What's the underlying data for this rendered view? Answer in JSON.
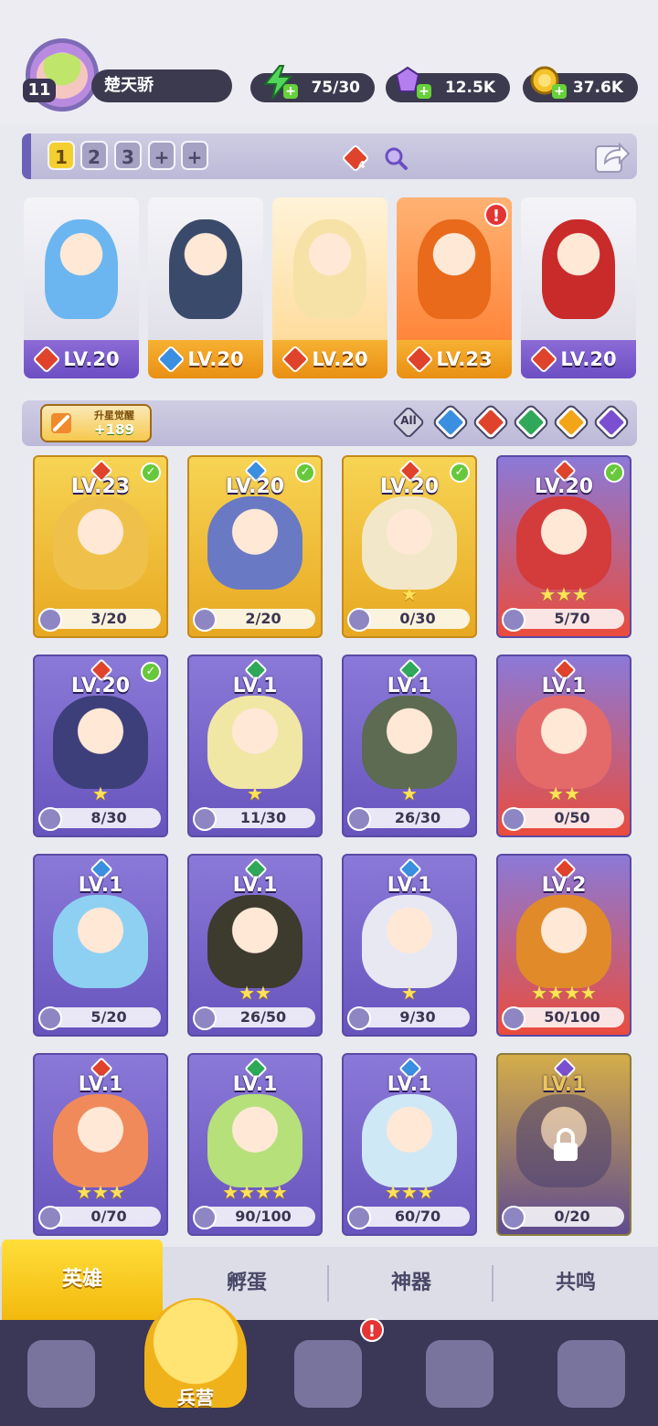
{
  "player": {
    "level": "11",
    "name": "楚天骄"
  },
  "resources": {
    "energy": "75/30",
    "gems": "12.5K",
    "coins": "37.6K"
  },
  "team_tabs": [
    "1",
    "2",
    "3",
    "+",
    "+"
  ],
  "team_indicator": {
    "count": "4"
  },
  "lineup": [
    {
      "level": "LV.20",
      "element": "fire",
      "band": "purple"
    },
    {
      "level": "LV.20",
      "element": "water",
      "band": "gold"
    },
    {
      "level": "LV.20",
      "element": "fire",
      "band": "gold"
    },
    {
      "level": "LV.23",
      "element": "fire",
      "band": "gold",
      "alert": "!"
    },
    {
      "level": "LV.20",
      "element": "fire",
      "band": "purple"
    }
  ],
  "upgrade": {
    "label": "升星觉醒",
    "value": "+189"
  },
  "filters": [
    "All",
    "water",
    "fire",
    "nature",
    "light",
    "dark"
  ],
  "heroes": [
    {
      "level": "LV.23",
      "element": "fire",
      "shards": "3/20",
      "checked": true,
      "style": "gold",
      "stars": 0
    },
    {
      "level": "LV.20",
      "element": "water",
      "shards": "2/20",
      "checked": true,
      "style": "gold",
      "stars": 0
    },
    {
      "level": "LV.20",
      "element": "fire",
      "shards": "0/30",
      "checked": true,
      "style": "gold",
      "stars": 1
    },
    {
      "level": "LV.20",
      "element": "fire",
      "shards": "5/70",
      "checked": true,
      "style": "red",
      "stars": 3
    },
    {
      "level": "LV.20",
      "element": "fire",
      "shards": "8/30",
      "checked": true,
      "style": "purple",
      "stars": 1
    },
    {
      "level": "LV.1",
      "element": "nature",
      "shards": "11/30",
      "checked": false,
      "style": "purple",
      "stars": 1
    },
    {
      "level": "LV.1",
      "element": "nature",
      "shards": "26/30",
      "checked": false,
      "style": "purple",
      "stars": 1
    },
    {
      "level": "LV.1",
      "element": "fire",
      "shards": "0/50",
      "checked": false,
      "style": "red",
      "stars": 2
    },
    {
      "level": "LV.1",
      "element": "water",
      "shards": "5/20",
      "checked": false,
      "style": "purple",
      "stars": 0
    },
    {
      "level": "LV.1",
      "element": "nature",
      "shards": "26/50",
      "checked": false,
      "style": "purple",
      "stars": 2
    },
    {
      "level": "LV.1",
      "element": "water",
      "shards": "9/30",
      "checked": false,
      "style": "purple",
      "stars": 1
    },
    {
      "level": "LV.2",
      "element": "fire",
      "shards": "50/100",
      "checked": false,
      "style": "red",
      "stars": 4
    },
    {
      "level": "LV.1",
      "element": "fire",
      "shards": "0/70",
      "checked": false,
      "style": "purple",
      "stars": 3
    },
    {
      "level": "LV.1",
      "element": "nature",
      "shards": "90/100",
      "checked": false,
      "style": "purple",
      "stars": 4
    },
    {
      "level": "LV.1",
      "element": "water",
      "shards": "60/70",
      "checked": false,
      "style": "purple",
      "stars": 3
    },
    {
      "level": "LV.1",
      "element": "dark",
      "shards": "0/20",
      "checked": false,
      "style": "locked",
      "stars": 0,
      "locked": true
    }
  ],
  "tabs": [
    "英雄",
    "孵蛋",
    "神器",
    "共鸣"
  ],
  "nav": {
    "center_label": "兵营",
    "alert": "!"
  },
  "colors": {
    "fire": "#e0432b",
    "water": "#3a8fe0",
    "nature": "#2fa85a",
    "light": "#f2a516",
    "dark": "#7a4fd0"
  }
}
